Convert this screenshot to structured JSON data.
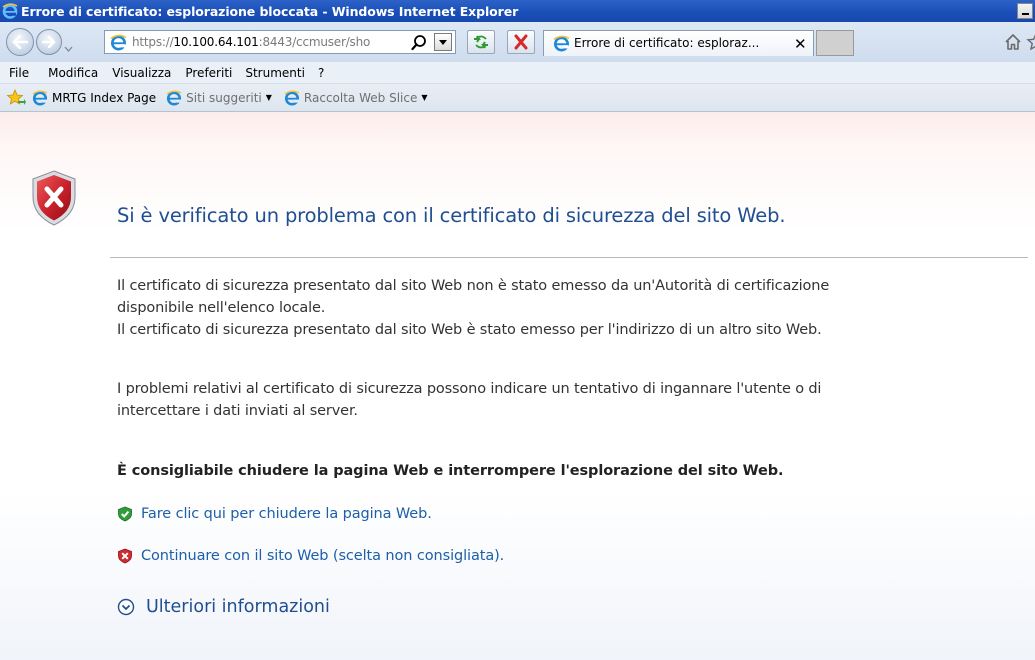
{
  "window": {
    "title": "Errore di certificato: esplorazione bloccata - Windows Internet Explorer"
  },
  "navbar": {
    "url_prefix": "https://",
    "url_host": "10.100.64.101",
    "url_rest": ":8443/ccmuser/sho",
    "tab_label": "Errore di certificato: esploraz...",
    "tab_close": "✕"
  },
  "menu": {
    "items": [
      "File",
      "Modifica",
      "Visualizza",
      "Preferiti",
      "Strumenti",
      "?"
    ]
  },
  "favorites": {
    "items": [
      {
        "label": "MRTG Index Page"
      },
      {
        "label": "Siti suggeriti"
      },
      {
        "label": "Raccolta Web Slice"
      }
    ]
  },
  "content": {
    "title": "Si è verificato un problema con il certificato di sicurezza del sito Web.",
    "para1_line1": "Il certificato di sicurezza presentato dal sito Web non è stato emesso da un'Autorità di certificazione",
    "para1_line2": "disponibile nell'elenco locale.",
    "para1_line3": "Il certificato di sicurezza presentato dal sito Web è stato emesso per l'indirizzo di un altro sito Web.",
    "para2_line1": "I problemi relativi al certificato di sicurezza possono indicare un tentativo di ingannare l'utente o di",
    "para2_line2": "intercettare i dati inviati al server.",
    "warning": "È consigliabile chiudere la pagina Web e interrompere l'esplorazione del sito Web.",
    "close_link": "Fare clic qui per chiudere la pagina Web.",
    "continue_link": "Continuare con il sito Web (scelta non consigliata).",
    "more_info": "Ulteriori informazioni"
  },
  "colors": {
    "title_bar": "#1a4fb8",
    "heading": "#1f4f90",
    "link": "#1d5fa8",
    "shield_red": "#c8202a"
  }
}
